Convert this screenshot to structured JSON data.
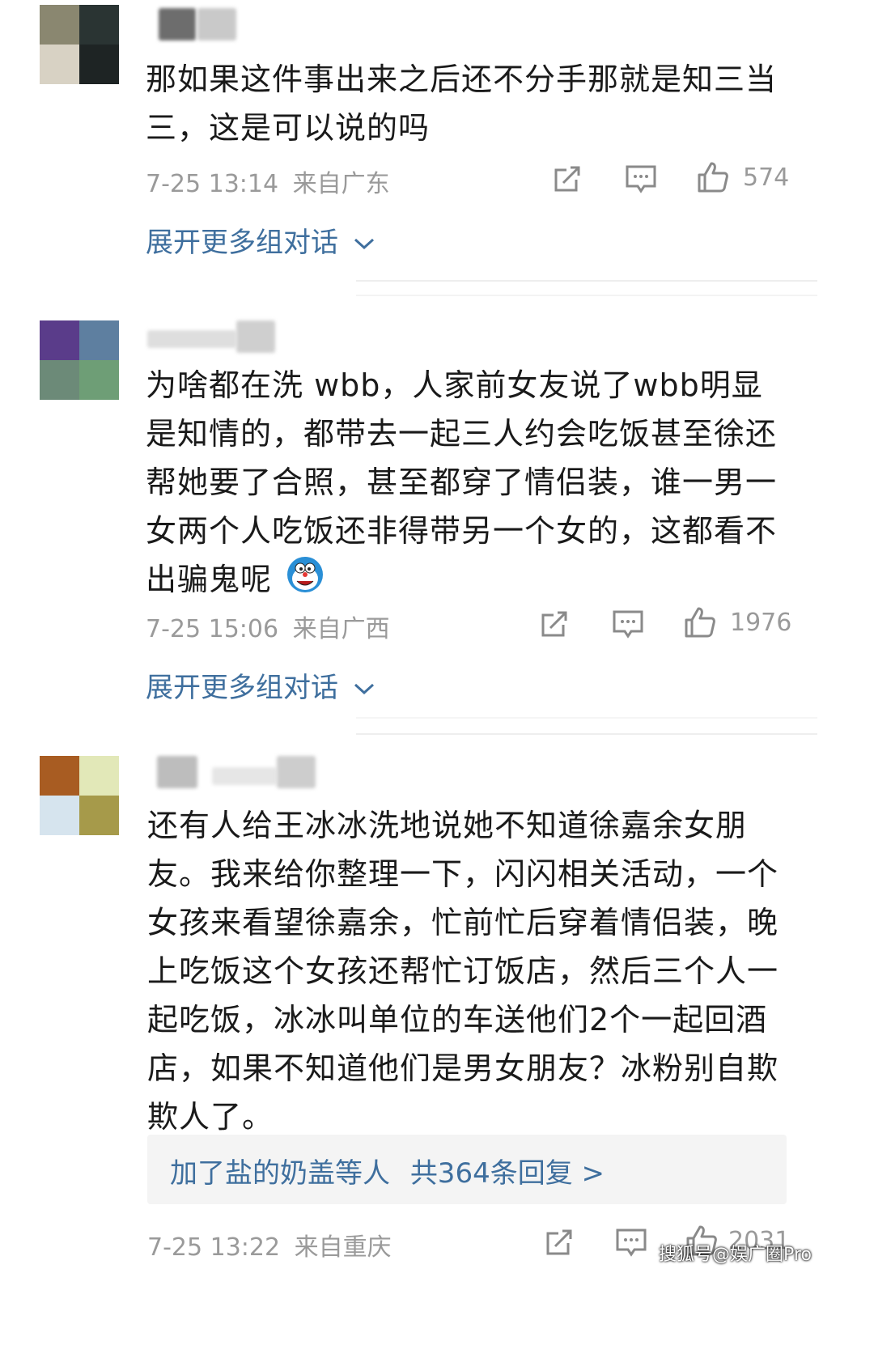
{
  "comments": [
    {
      "text_lines": [
        "那如果这件事出来之后还不分手那就是知三当",
        "三，这是可以说的吗"
      ],
      "time": "7-25 13:14",
      "location": "来自广东",
      "likes": "574",
      "expand_label": "展开更多组对话",
      "avatar_colors": [
        "#8a8770",
        "#2a3433",
        "#d8d2c4",
        "#1e2424"
      ]
    },
    {
      "text_lines": [
        "为啥都在洗 wbb，人家前女友说了wbb明显",
        "是知情的，都带去一起三人约会吃饭甚至徐还",
        "帮她要了合照，甚至都穿了情侣装，谁一男一",
        "女两个人吃饭还非得带另一个女的，这都看不",
        "出骗鬼呢"
      ],
      "time": "7-25 15:06",
      "location": "来自广西",
      "likes": "1976",
      "expand_label": "展开更多组对话",
      "avatar_colors": [
        "#5a3c8a",
        "#5e7fa0",
        "#6c8a78",
        "#6e9e76"
      ]
    },
    {
      "text_lines": [
        "还有人给王冰冰洗地说她不知道徐嘉余女朋",
        "友。我来给你整理一下，闪闪相关活动，一个",
        "女孩来看望徐嘉余，忙前忙后穿着情侣装，晚",
        "上吃饭这个女孩还帮忙订饭店，然后三个人一",
        "起吃饭，冰冰叫单位的车送他们2个一起回酒",
        "店，如果不知道他们是男女朋友？冰粉别自欺",
        "欺人了。"
      ],
      "time": "7-25 13:22",
      "location": "来自重庆",
      "likes": "2031",
      "reply_users": "加了盐的奶盖等人",
      "reply_count": "共364条回复 >",
      "avatar_colors": [
        "#a85c22",
        "#e2e8b8",
        "#d6e4ee",
        "#a69a4a"
      ]
    }
  ],
  "icons": {
    "share": "share-icon",
    "comment": "comment-icon",
    "like": "thumbs-up-icon",
    "chevron": "chevron-down-icon",
    "emoji": "doraemon-emoji-icon"
  },
  "watermark": "搜狐号@娱广圈Pro",
  "colors": {
    "link": "#3f6f9e",
    "meta": "#9a9a9a",
    "text": "#1a1a1a"
  }
}
